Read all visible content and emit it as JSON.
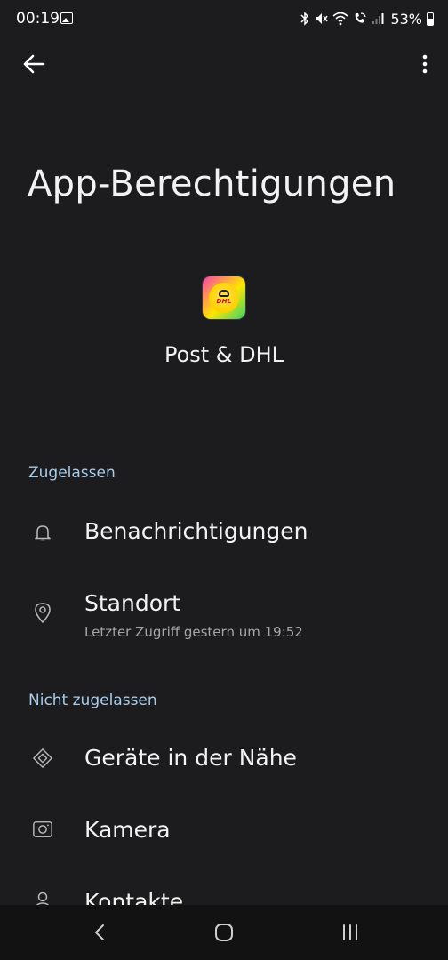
{
  "status_bar": {
    "time": "00:19",
    "battery": "53%",
    "battery_level": 0.53,
    "icons": [
      "gallery-icon",
      "bluetooth-icon",
      "mute-icon",
      "wifi-icon",
      "wifi-call-icon",
      "signal-icon",
      "battery-icon"
    ]
  },
  "app_bar": {
    "back_icon": "arrow-left-icon",
    "menu_icon": "more-vertical-icon"
  },
  "page": {
    "title": "App-Berechtigungen"
  },
  "app": {
    "name": "Post & DHL",
    "icon_text": "DHL"
  },
  "sections": {
    "allowed": {
      "header": "Zugelassen",
      "items": [
        {
          "label": "Benachrichtigungen",
          "icon": "bell-icon"
        },
        {
          "label": "Standort",
          "sublabel": "Letzter Zugriff gestern um 19:52",
          "icon": "location-pin-icon"
        }
      ]
    },
    "not_allowed": {
      "header": "Nicht zugelassen",
      "items": [
        {
          "label": "Geräte in der Nähe",
          "icon": "nearby-devices-icon"
        },
        {
          "label": "Kamera",
          "icon": "camera-icon"
        },
        {
          "label": "Kontakte",
          "icon": "contacts-icon"
        }
      ]
    }
  },
  "nav_bar": {
    "back": "nav-back-icon",
    "home": "nav-home-icon",
    "recents": "nav-recents-icon"
  },
  "colors": {
    "background": "#1c1c1e",
    "section_header": "#a7cdec",
    "secondary_text": "#a6a6a6",
    "nav_bar": "#121212"
  }
}
